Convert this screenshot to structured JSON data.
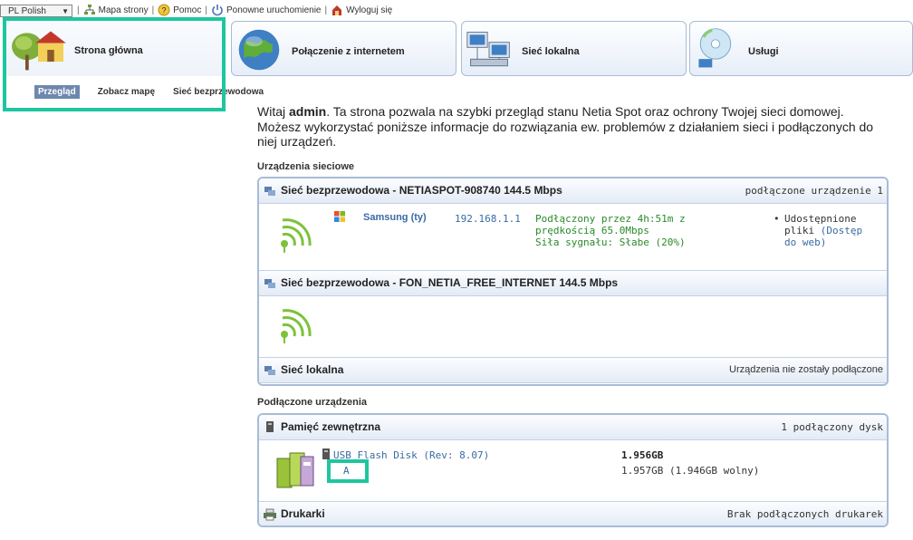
{
  "topbar": {
    "language": "PL Polish",
    "links": [
      "Mapa strony",
      "Pomoc",
      "Ponowne uruchomienie",
      "Wyloguj się"
    ]
  },
  "nav": {
    "tabs": [
      {
        "label": "Strona główna",
        "icon": "house-tree-icon"
      },
      {
        "label": "Połączenie z internetem",
        "icon": "globe-icon"
      },
      {
        "label": "Sieć lokalna",
        "icon": "network-computers-icon"
      },
      {
        "label": "Usługi",
        "icon": "disc-icon"
      }
    ],
    "subtabs": [
      "Przegląd",
      "Zobacz mapę",
      "Sieć bezprzewodowa"
    ]
  },
  "intro": {
    "prefix": "Witaj ",
    "user": "admin",
    "text": ". Ta strona pozwala na szybki przegląd stanu Netia Spot oraz ochrony Twojej sieci domowej. Możesz wykorzystać poniższe informacje do rozwiązania ew. problemów z działaniem sieci i podłączonych do niej urządzeń."
  },
  "network_devices": {
    "title": "Urządzenia sieciowe",
    "wireless1": {
      "title": "Sieć bezprzewodowa - NETIASPOT-908740 144.5 Mbps",
      "status": "podłączone urządzenie 1",
      "device_name": "Samsung (ty)",
      "ip": "192.168.1.1",
      "conn_line1": "Podłączony przez 4h:51m z",
      "conn_line2": "prędkością 65.0Mbps",
      "conn_line3": "Siła sygnału: Słabe (20%)",
      "share_text": "Udostępnione pliki",
      "share_link": "(Dostęp do web)"
    },
    "wireless2": {
      "title": "Sieć bezprzewodowa - FON_NETIA_FREE_INTERNET 144.5 Mbps"
    },
    "lan": {
      "title": "Sieć lokalna",
      "status": "Urządzenia nie zostały podłączone"
    }
  },
  "connected_devices": {
    "title": "Podłączone urządzenia",
    "storage": {
      "title": "Pamięć zewnętrzna",
      "status": "1 podłączony dysk",
      "disk_name": "USB Flash Disk (Rev: 8.07)",
      "partition": "A",
      "size": "1.956GB",
      "free": "1.957GB (1.946GB wolny)"
    },
    "printers": {
      "title": "Drukarki",
      "status": "Brak podłączonych drukarek"
    }
  },
  "colors": {
    "accent": "#1ec6a0",
    "link": "#3a6aa5",
    "panel_border": "#a8bcd6"
  }
}
